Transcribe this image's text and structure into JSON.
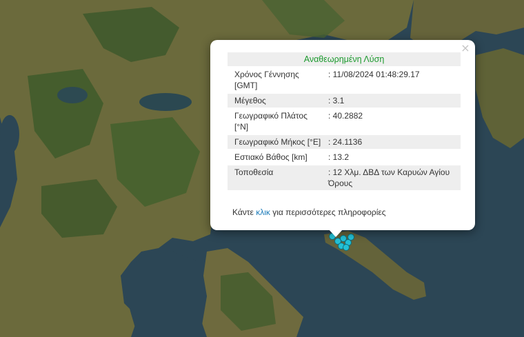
{
  "popup": {
    "title": "Αναθεωρημένη Λύση",
    "close_icon": "×",
    "rows": [
      {
        "label": "Χρόνος Γέννησης [GMT]",
        "value": ": 11/08/2024 01:48:29.17"
      },
      {
        "label": "Μέγεθος",
        "value": ": 3.1"
      },
      {
        "label": "Γεωγραφικό Πλάτος [°N]",
        "value": ": 40.2882"
      },
      {
        "label": "Γεωγραφικό Μήκος [°E]",
        "value": ": 24.1136"
      },
      {
        "label": "Εστιακό Βάθος [km]",
        "value": ": 13.2"
      },
      {
        "label": "Τοποθεσία",
        "value": ": 12 Χλμ. ΔΒΔ των Καρυών Αγίου Όρους"
      }
    ],
    "more_prefix": "Κάντε ",
    "more_link": "κλικ",
    "more_suffix": " για περισσότερες πληροφορίες"
  },
  "map": {
    "land_color": "#6b6a3c",
    "forest_color": "#405a2c",
    "sea_color": "#2c4655",
    "marker_color": "#23c1d6"
  }
}
